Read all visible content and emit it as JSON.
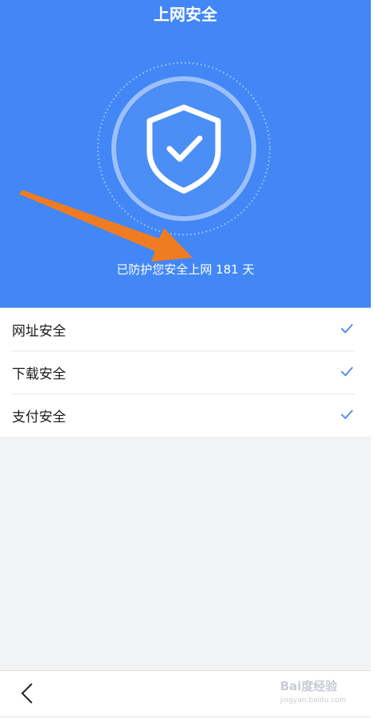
{
  "header": {
    "title": "上网安全",
    "status_text": "已防护您安全上网 181 天",
    "background_color": "#4287f5"
  },
  "list": {
    "items": [
      {
        "label": "网址安全",
        "checked": true
      },
      {
        "label": "下载安全",
        "checked": true
      },
      {
        "label": "支付安全",
        "checked": true
      }
    ],
    "check_color": "#4a86e8"
  },
  "annotation": {
    "arrow_color": "#f07c22"
  },
  "bottom_bar": {
    "back_icon": "chevron-left-icon"
  },
  "watermark": {
    "logo": "Bai度经验",
    "url": "jingyan.baidu.com"
  }
}
